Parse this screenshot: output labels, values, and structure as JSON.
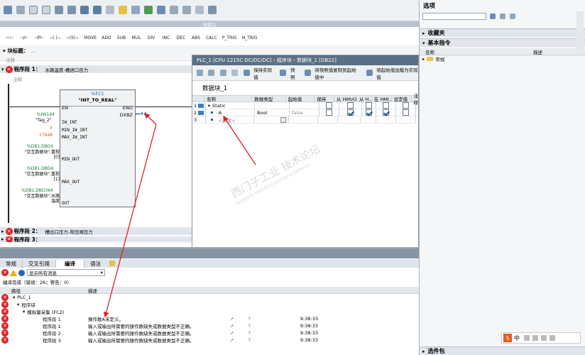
{
  "toolbar": {
    "top_left_title": "块接口",
    "ladder_buttons": [
      "⊣ ⊢",
      "⊣/⊢",
      "⊣P⊢",
      "−( )−",
      "−(S)−",
      "MOVE",
      "ADD",
      "SUB",
      "MUL",
      "DIV",
      "INC",
      "DEC",
      "ABS",
      "CALC",
      "P_TRIG",
      "N_TRIG"
    ]
  },
  "block_title": {
    "label": "块标题：",
    "comment_label": "注释"
  },
  "network1": {
    "label": "程序段 1：",
    "title": "水路温度-槽进口压力",
    "comment": "注释"
  },
  "fb": {
    "instance": "%FC1",
    "name": "\"INT_TO_REAL\"",
    "en": "EN",
    "eno": "ENO",
    "out_pin": "DXBZ",
    "out_val": "#A",
    "inputs": [
      {
        "addr": "%IW144",
        "tag": "\"Tag_2\"",
        "pin": "IW_INT"
      },
      {
        "addr": "",
        "tag": "0",
        "pin": "MIN_IW_INT"
      },
      {
        "addr": "",
        "tag": "27648",
        "pin": "MAX_IW_INT"
      },
      {
        "addr": "%DB1.DBD0",
        "tag": "\"交互数据块\".重程[0]",
        "pin": "MIN_OUT"
      },
      {
        "addr": "%DB1.DBD4",
        "tag": "\"交互数据块\".重程[1]",
        "pin": "MAX_OUT"
      },
      {
        "addr": "%DB1.DBD364",
        "tag": "\"交互数据块\".水路温度",
        "pin": "OUT"
      }
    ]
  },
  "network2": {
    "label": "程序段 2：",
    "title": "槽出口压力-背压阀压力"
  },
  "network3": {
    "label": "程序段 3："
  },
  "db_window": {
    "breadcrumb": "PLC_1 [CPU 1215C DC/DC/DC]  ›  程序块  ›  数据块_1 [DB22]",
    "toolbar_items": [
      "保持实际值",
      "快照",
      "将快照值复制到起始值中",
      "将起始值加载为实际值"
    ],
    "title": "数据块_1",
    "columns": [
      "名称",
      "数据类型",
      "起始值",
      "保持",
      "从 HMI/OPC...",
      "从 H...",
      "在 HMI...",
      "设定值",
      "注释"
    ],
    "rows": [
      {
        "num": "1",
        "name": "Static",
        "type": "",
        "start": "",
        "retain": false,
        "hmi1": false,
        "hmi2": false,
        "hmi3": false,
        "setp": false
      },
      {
        "num": "2",
        "name": "A",
        "type": "Bool",
        "start": "false",
        "retain": false,
        "hmi1": true,
        "hmi2": true,
        "hmi3": true,
        "setp": false
      },
      {
        "num": "3",
        "name": "<新增>",
        "type": "",
        "start": "",
        "retain": false,
        "hmi1": false,
        "hmi2": false,
        "hmi3": false,
        "setp": false
      }
    ]
  },
  "right_panel": {
    "title": "选项",
    "favorites": "收藏夹",
    "basic": "基本指令",
    "col_name": "名称",
    "col_desc": "描述",
    "item": "常规",
    "bottom": "选件包"
  },
  "bottom_panel": {
    "tabs": [
      "常规",
      "交叉引用",
      "编译",
      "语法"
    ],
    "filter": "显示所有消息",
    "summary": "编译完成（错误：26；警告：0）",
    "col_path": "路径",
    "col_desc": "描述",
    "tree": [
      "PLC_1",
      "程序块",
      "模拟量采集 (FC2)"
    ],
    "rows": [
      {
        "path": "程序段 1",
        "desc": "操作数A未定义。",
        "time": "9:38:33"
      },
      {
        "path": "程序段 1",
        "desc": "输入或输出所需要的操作数缺失或数据类型不正确。",
        "time": "9:38:33"
      },
      {
        "path": "程序段 2",
        "desc": "输入或输出所需要的操作数缺失或数据类型不正确。",
        "time": "9:38:33"
      },
      {
        "path": "程序段 3",
        "desc": "输入或输出所需要的操作数缺失或数据类型不正确。",
        "time": "9:38:33"
      }
    ]
  },
  "ime": {
    "label": "中"
  },
  "watermark": {
    "line1": "西门子工业  技术论坛",
    "line2": "support.industry.siemens.com/cs"
  }
}
